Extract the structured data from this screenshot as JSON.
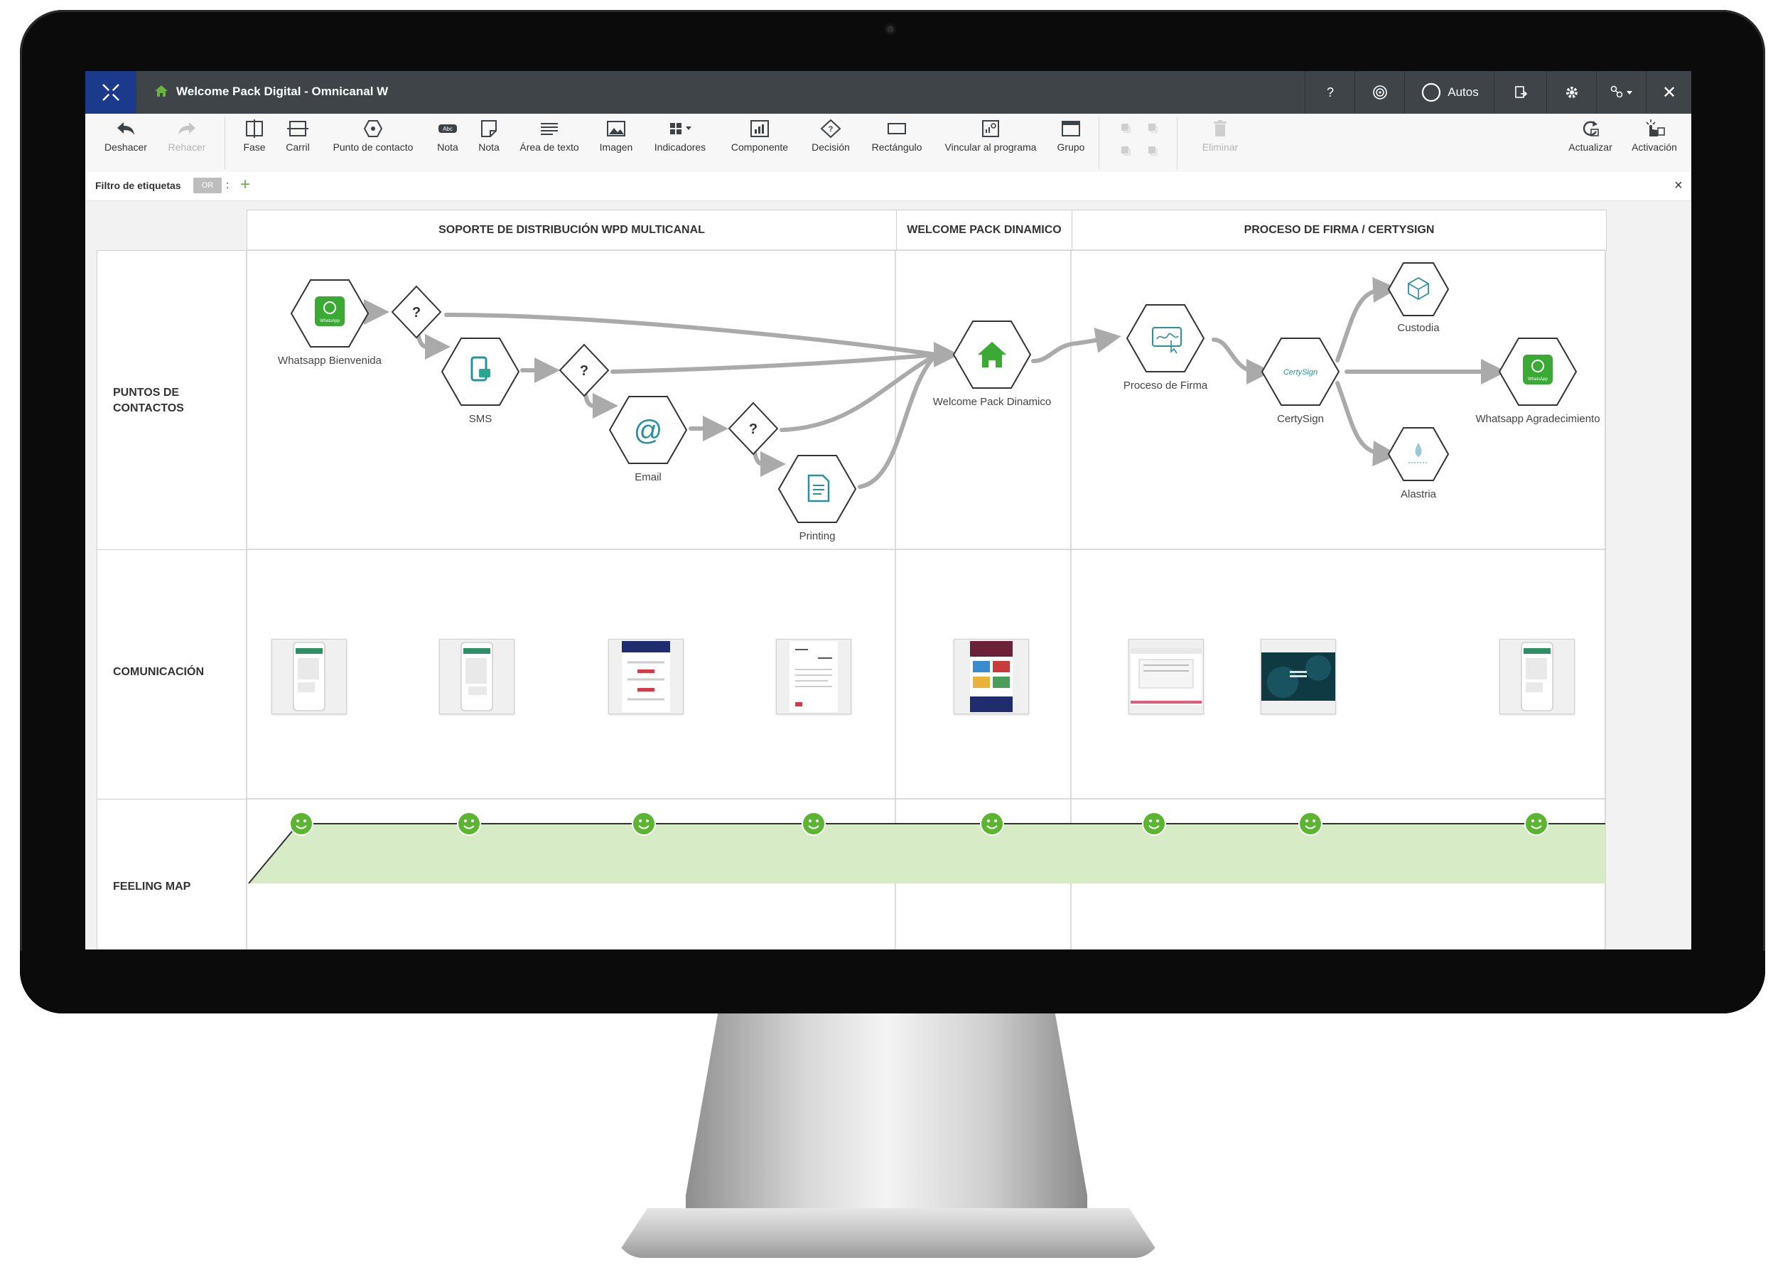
{
  "window": {
    "title": "Welcome Pack Digital - Omnicanal W",
    "help_label": "?",
    "autos_label": "Autos",
    "close_label": "✕"
  },
  "toolbar": {
    "items": [
      {
        "label": "Deshacer",
        "icon": "undo-icon",
        "enabled": true
      },
      {
        "label": "Rehacer",
        "icon": "redo-icon",
        "enabled": false
      },
      {
        "label": "Fase",
        "icon": "phase-icon",
        "enabled": true
      },
      {
        "label": "Carril",
        "icon": "lane-icon",
        "enabled": true
      },
      {
        "label": "Punto de contacto",
        "icon": "touchpoint-icon",
        "enabled": true
      },
      {
        "label": "Nota",
        "icon": "note-abc-icon",
        "enabled": true
      },
      {
        "label": "Nota",
        "icon": "note-icon",
        "enabled": true
      },
      {
        "label": "Área de texto",
        "icon": "text-area-icon",
        "enabled": true
      },
      {
        "label": "Imagen",
        "icon": "image-icon",
        "enabled": true
      },
      {
        "label": "Indicadores",
        "icon": "indicators-icon",
        "enabled": true
      },
      {
        "label": "Componente",
        "icon": "component-icon",
        "enabled": true
      },
      {
        "label": "Decisión",
        "icon": "decision-icon",
        "enabled": true
      },
      {
        "label": "Rectángulo",
        "icon": "rectangle-icon",
        "enabled": true
      },
      {
        "label": "Vincular al programa",
        "icon": "link-program-icon",
        "enabled": true
      },
      {
        "label": "Grupo",
        "icon": "group-icon",
        "enabled": true
      },
      {
        "label": "Eliminar",
        "icon": "trash-icon",
        "enabled": false
      },
      {
        "label": "Actualizar",
        "icon": "refresh-icon",
        "enabled": true
      },
      {
        "label": "Activación",
        "icon": "activation-icon",
        "enabled": true
      }
    ]
  },
  "filter": {
    "label": "Filtro de etiquetas",
    "operator": "OR",
    "colon": ":",
    "add": "+",
    "close": "×"
  },
  "phases": [
    "SOPORTE DE DISTRIBUCIÓN WPD MULTICANAL",
    "WELCOME PACK DINAMICO",
    "PROCESO DE FIRMA / CERTYSIGN"
  ],
  "lanes": [
    {
      "label_line1": "PUNTOS DE",
      "label_line2": "CONTACTOS"
    },
    {
      "label_line1": "COMUNICACIÓN",
      "label_line2": ""
    },
    {
      "label_line1": "FEELING MAP",
      "label_line2": ""
    }
  ],
  "touchpoints": [
    {
      "label": "Whatsapp Bienvenida",
      "icon": "whatsapp-icon"
    },
    {
      "label": "SMS",
      "icon": "sms-icon"
    },
    {
      "label": "Email",
      "icon": "at-sign-icon"
    },
    {
      "label": "Printing",
      "icon": "document-icon"
    },
    {
      "label": "Welcome Pack Dinamico",
      "icon": "home-icon"
    },
    {
      "label": "Proceso de Firma",
      "icon": "signature-icon"
    },
    {
      "label": "CertySign",
      "icon": "certysign-logo-icon"
    },
    {
      "label": "Custodia",
      "icon": "custody-icon"
    },
    {
      "label": "Alastria",
      "icon": "alastria-icon"
    },
    {
      "label": "Whatsapp Agradecimiento",
      "icon": "whatsapp-icon"
    }
  ],
  "decision_symbol": "?",
  "whatsapp_badge": "WhatsApp",
  "sms_badge": "SMS",
  "certysign_text": "CertySign",
  "feeling_map": {
    "points": 8,
    "mood": "happy",
    "fill_color": "#d6ebc6",
    "face_color": "#5cb531"
  },
  "colors": {
    "titlebar": "#3f4448",
    "logo_bg": "#1c3a8c",
    "accent_green": "#3aaa35",
    "teal": "#2a8fa0",
    "connector": "#aaaaaa"
  }
}
